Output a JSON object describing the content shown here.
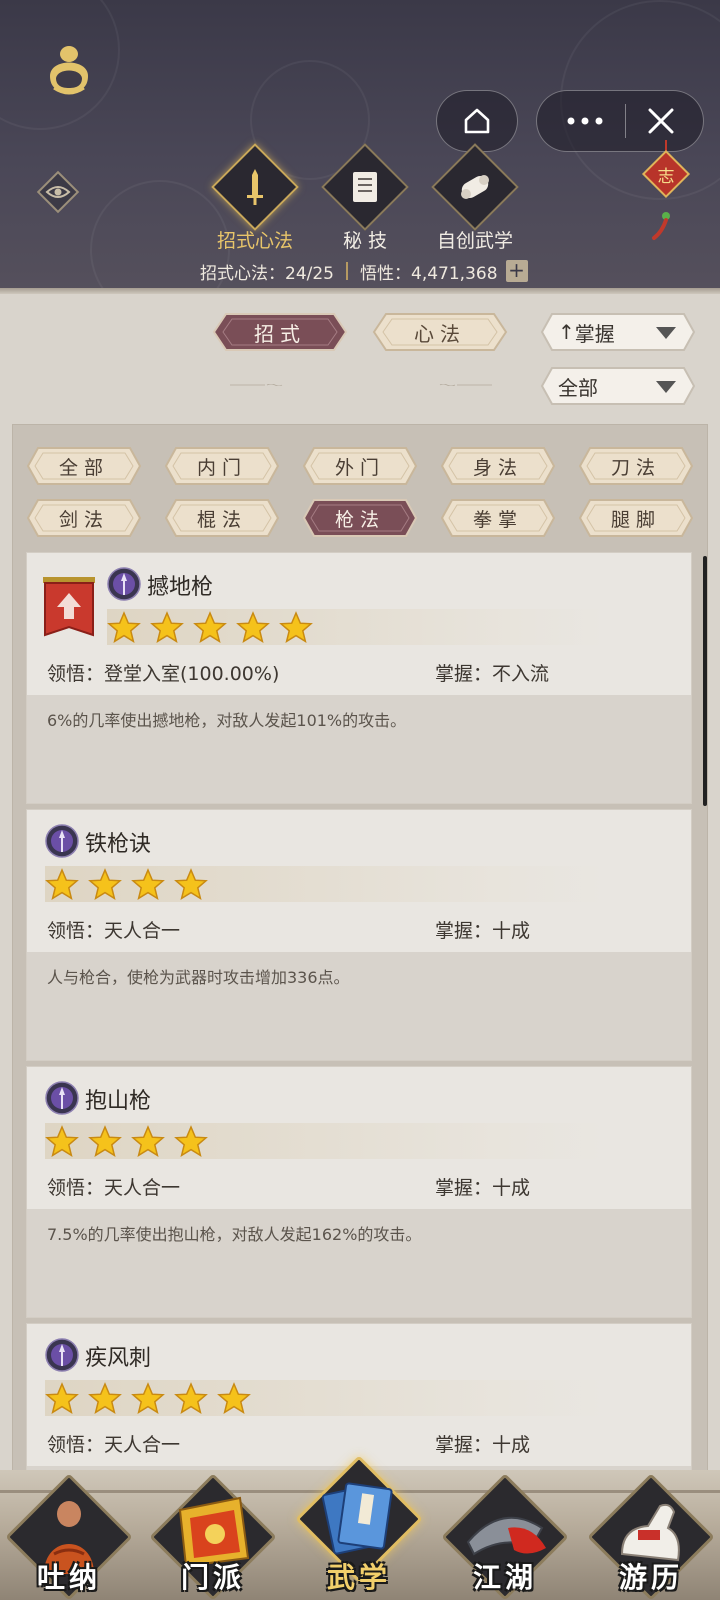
{
  "header": {
    "tabs": [
      {
        "label": "招式心法",
        "active": true,
        "icon": "sword-icon"
      },
      {
        "label": "秘 技",
        "active": false,
        "icon": "book-icon"
      },
      {
        "label": "自创武学",
        "active": false,
        "icon": "scroll-icon"
      }
    ],
    "stats": {
      "moves_label": "招式心法：24/25",
      "insight_label": "悟性：4,471,368",
      "add_symbol": "+"
    },
    "knot_char": "志"
  },
  "controls": {
    "type_tabs": [
      {
        "label": "招式",
        "selected": true
      },
      {
        "label": "心法",
        "selected": false
      }
    ],
    "sort_label": "掌握",
    "sort_arrow": "↑",
    "filter_label": "全部"
  },
  "filters": [
    {
      "label": "全部",
      "selected": false
    },
    {
      "label": "内门",
      "selected": false
    },
    {
      "label": "外门",
      "selected": false
    },
    {
      "label": "身法",
      "selected": false
    },
    {
      "label": "刀法",
      "selected": false
    },
    {
      "label": "剑法",
      "selected": false
    },
    {
      "label": "棍法",
      "selected": false
    },
    {
      "label": "枪法",
      "selected": true
    },
    {
      "label": "拳掌",
      "selected": false
    },
    {
      "label": "腿脚",
      "selected": false
    }
  ],
  "skills": [
    {
      "name": "撼地枪",
      "stars": 5,
      "comprehension": "领悟：登堂入室(100.00%)",
      "mastery": "掌握：不入流",
      "description": "6%的几率使出撼地枪，对敌人发起101%的攻击。",
      "upgradable": true
    },
    {
      "name": "铁枪诀",
      "stars": 4,
      "comprehension": "领悟：天人合一",
      "mastery": "掌握：十成",
      "description": "人与枪合，使枪为武器时攻击增加336点。",
      "upgradable": false
    },
    {
      "name": "抱山枪",
      "stars": 4,
      "comprehension": "领悟：天人合一",
      "mastery": "掌握：十成",
      "description": "7.5%的几率使出抱山枪，对敌人发起162%的攻击。",
      "upgradable": false
    },
    {
      "name": "疾风刺",
      "stars": 5,
      "comprehension": "领悟：天人合一",
      "mastery": "掌握：十成",
      "description": "",
      "upgradable": false
    }
  ],
  "bottom_nav": [
    {
      "label": "吐纳",
      "active": false
    },
    {
      "label": "门派",
      "active": false
    },
    {
      "label": "武学",
      "active": true
    },
    {
      "label": "江湖",
      "active": false
    },
    {
      "label": "游历",
      "active": false
    }
  ],
  "colors": {
    "header_bg": "#4a4757",
    "accent_gold": "#e8c56a",
    "selected_tag": "#7a4e57",
    "star": "#f5c21b"
  }
}
